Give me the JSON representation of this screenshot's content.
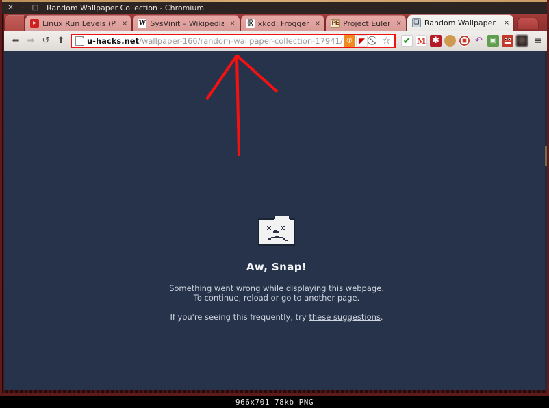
{
  "window": {
    "title": "Random Wallpaper Collection - Chromium",
    "buttons": [
      {
        "name": "close",
        "glyph": "✕"
      },
      {
        "name": "minimize",
        "glyph": "–"
      },
      {
        "name": "maximize",
        "glyph": "□"
      }
    ]
  },
  "tabs": [
    {
      "label": "",
      "favicon": "fav-clipped",
      "icon_name": "clipped-tab",
      "close": "",
      "active": false,
      "clipped": true
    },
    {
      "label": "Linux Run Levels (Pa",
      "favicon": "fav-youtube",
      "icon_name": "youtube-favicon",
      "close": "×",
      "active": false,
      "clipped": false
    },
    {
      "label": "SysVinit – Wikipedia",
      "favicon": "fav-wiki",
      "icon_name": "wikipedia-favicon",
      "favicon_text": "W",
      "close": "×",
      "active": false,
      "clipped": false
    },
    {
      "label": "xkcd: Frogger",
      "favicon": "fav-xkcd",
      "icon_name": "xkcd-favicon",
      "favicon_text": "▒",
      "close": "×",
      "active": false,
      "clipped": false
    },
    {
      "label": "Project Euler",
      "favicon": "fav-euler",
      "icon_name": "project-euler-favicon",
      "favicon_text": "PE",
      "close": "×",
      "active": false,
      "clipped": false
    },
    {
      "label": "Random Wallpaper C",
      "favicon": "fav-image",
      "icon_name": "image-favicon",
      "favicon_text": "❑",
      "close": "×",
      "active": true,
      "clipped": false
    }
  ],
  "newtab_label": "",
  "toolbar": {
    "back": "⬅",
    "forward": "➡",
    "reload": "↺",
    "home": "⬆",
    "url_host": "u-hacks.net",
    "url_path": "/wallpaper-166/random-wallpaper-collection-17941/",
    "url_full": "u-hacks.net/wallpaper-166/random-wallpaper-collection-17941/",
    "omni_icons": [
      {
        "name": "rss-icon",
        "glyph": "⦶",
        "cls": "ico-rss"
      },
      {
        "name": "flash-icon",
        "glyph": "◤",
        "cls": "ico-flash"
      },
      {
        "name": "noscript-icon",
        "glyph": "⃠",
        "cls": "ico-noscript"
      },
      {
        "name": "bookmark-star-icon",
        "glyph": "☆",
        "cls": "ico-star"
      }
    ],
    "extensions": [
      {
        "name": "checkmark-extension-icon",
        "glyph": "✔",
        "cls": "e-check"
      },
      {
        "name": "gmail-extension-icon",
        "glyph": "M",
        "cls": "e-gmail"
      },
      {
        "name": "asterisk-extension-icon",
        "glyph": "✱",
        "cls": "e-asterisk"
      },
      {
        "name": "cookie-extension-icon",
        "glyph": "●",
        "cls": "e-cookie"
      },
      {
        "name": "adblock-extension-icon",
        "glyph": "✋",
        "cls": "e-adblock"
      },
      {
        "name": "refresh-arrow-extension-icon",
        "glyph": "↶",
        "cls": "e-arrow"
      },
      {
        "name": "screen-extension-icon",
        "glyph": "▣",
        "cls": "e-screen"
      },
      {
        "name": "smiley-extension-icon",
        "glyph": "☺",
        "cls": "e-face"
      },
      {
        "name": "blurred-extension-icon",
        "glyph": "",
        "cls": "e-blur"
      }
    ],
    "menu": "≡"
  },
  "page": {
    "title": "Aw, Snap!",
    "line1": "Something went wrong while displaying this webpage.",
    "line2": "To continue, reload or go to another page.",
    "freq_prefix": "If you're seeing this frequently, try ",
    "freq_link": "these suggestions",
    "freq_suffix": "."
  },
  "annotation": {
    "color": "#f51111",
    "shape": "up-arrow",
    "points": "tip(340,5) left-wing(297,70) right-wing(399,59) shaft-end(343,153)"
  },
  "statusbar": {
    "text": "966x701 78kb PNG"
  },
  "colors": {
    "page_background": "#26334a",
    "tabstrip": "#9e3a38",
    "omnibox_highlight": "#f01313",
    "frame": "#5d1b1c",
    "titlebar": "#2b2422"
  }
}
